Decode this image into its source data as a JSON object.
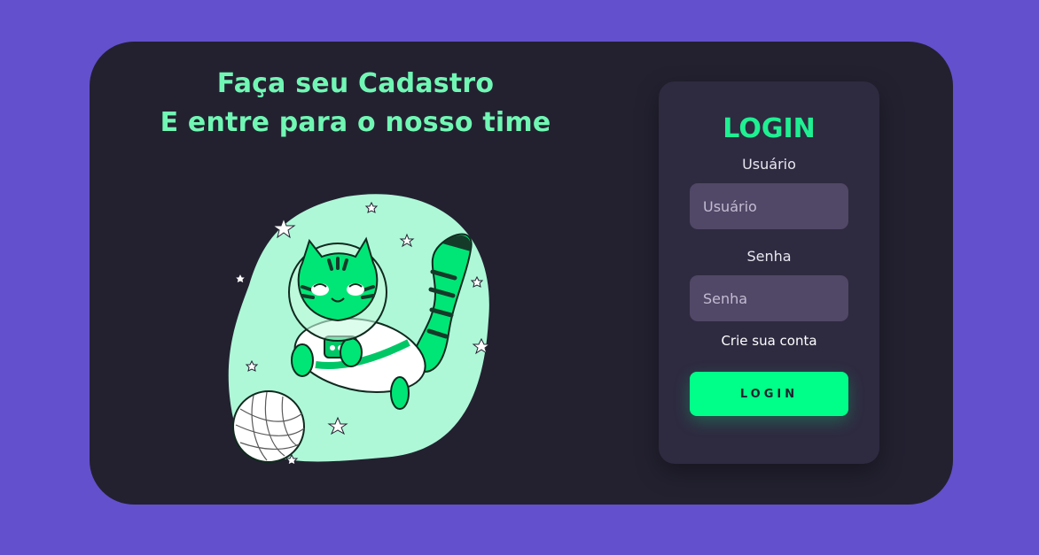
{
  "hero": {
    "line1": "Faça seu Cadastro",
    "line2": "E entre para o nosso time"
  },
  "illustration": {
    "subject": "astronaut-cat-icon",
    "colors": {
      "blob": "#aef8d8",
      "cat": "#00e676",
      "stripe": "#163a2a"
    }
  },
  "login": {
    "title": "LOGIN",
    "username_label": "Usuário",
    "username_placeholder": "Usuário",
    "password_label": "Senha",
    "password_placeholder": "Senha",
    "create_account": "Crie sua conta",
    "button": "LOGIN"
  },
  "colors": {
    "background": "#6350cd",
    "card": "#232130",
    "panel": "#2e2a40",
    "accent": "#00ff88",
    "headline": "#71f7b4"
  }
}
